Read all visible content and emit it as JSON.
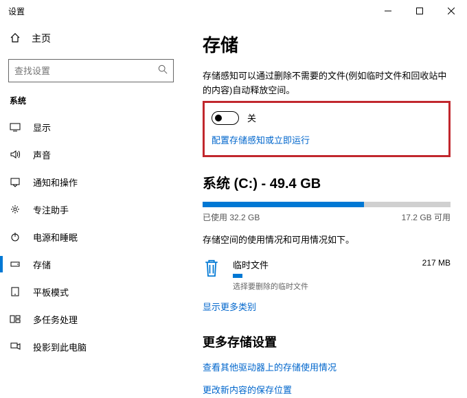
{
  "titlebar": {
    "text": "设置"
  },
  "home": {
    "label": "主页"
  },
  "search": {
    "placeholder": "查找设置"
  },
  "category_header": "系统",
  "nav": [
    {
      "label": "显示"
    },
    {
      "label": "声音"
    },
    {
      "label": "通知和操作"
    },
    {
      "label": "专注助手"
    },
    {
      "label": "电源和睡眠"
    },
    {
      "label": "存储"
    },
    {
      "label": "平板模式"
    },
    {
      "label": "多任务处理"
    },
    {
      "label": "投影到此电脑"
    }
  ],
  "page": {
    "title": "存储",
    "description": "存储感知可以通过删除不需要的文件(例如临时文件和回收站中的内容)自动释放空间。",
    "toggle_state": "关",
    "config_link": "配置存储感知或立即运行",
    "drive_header": "系统 (C:) - 49.4 GB",
    "used_text": "已使用 32.2 GB",
    "free_text": "17.2 GB 可用",
    "fill_pct": 65,
    "usage_desc": "存储空间的使用情况和可用情况如下。",
    "temp": {
      "title": "临时文件",
      "sub": "选择要删除的临时文件",
      "size": "217 MB"
    },
    "show_more": "显示更多类别",
    "more_settings_hdr": "更多存储设置",
    "more1": "查看其他驱动器上的存储使用情况",
    "more2": "更改新内容的保存位置"
  }
}
